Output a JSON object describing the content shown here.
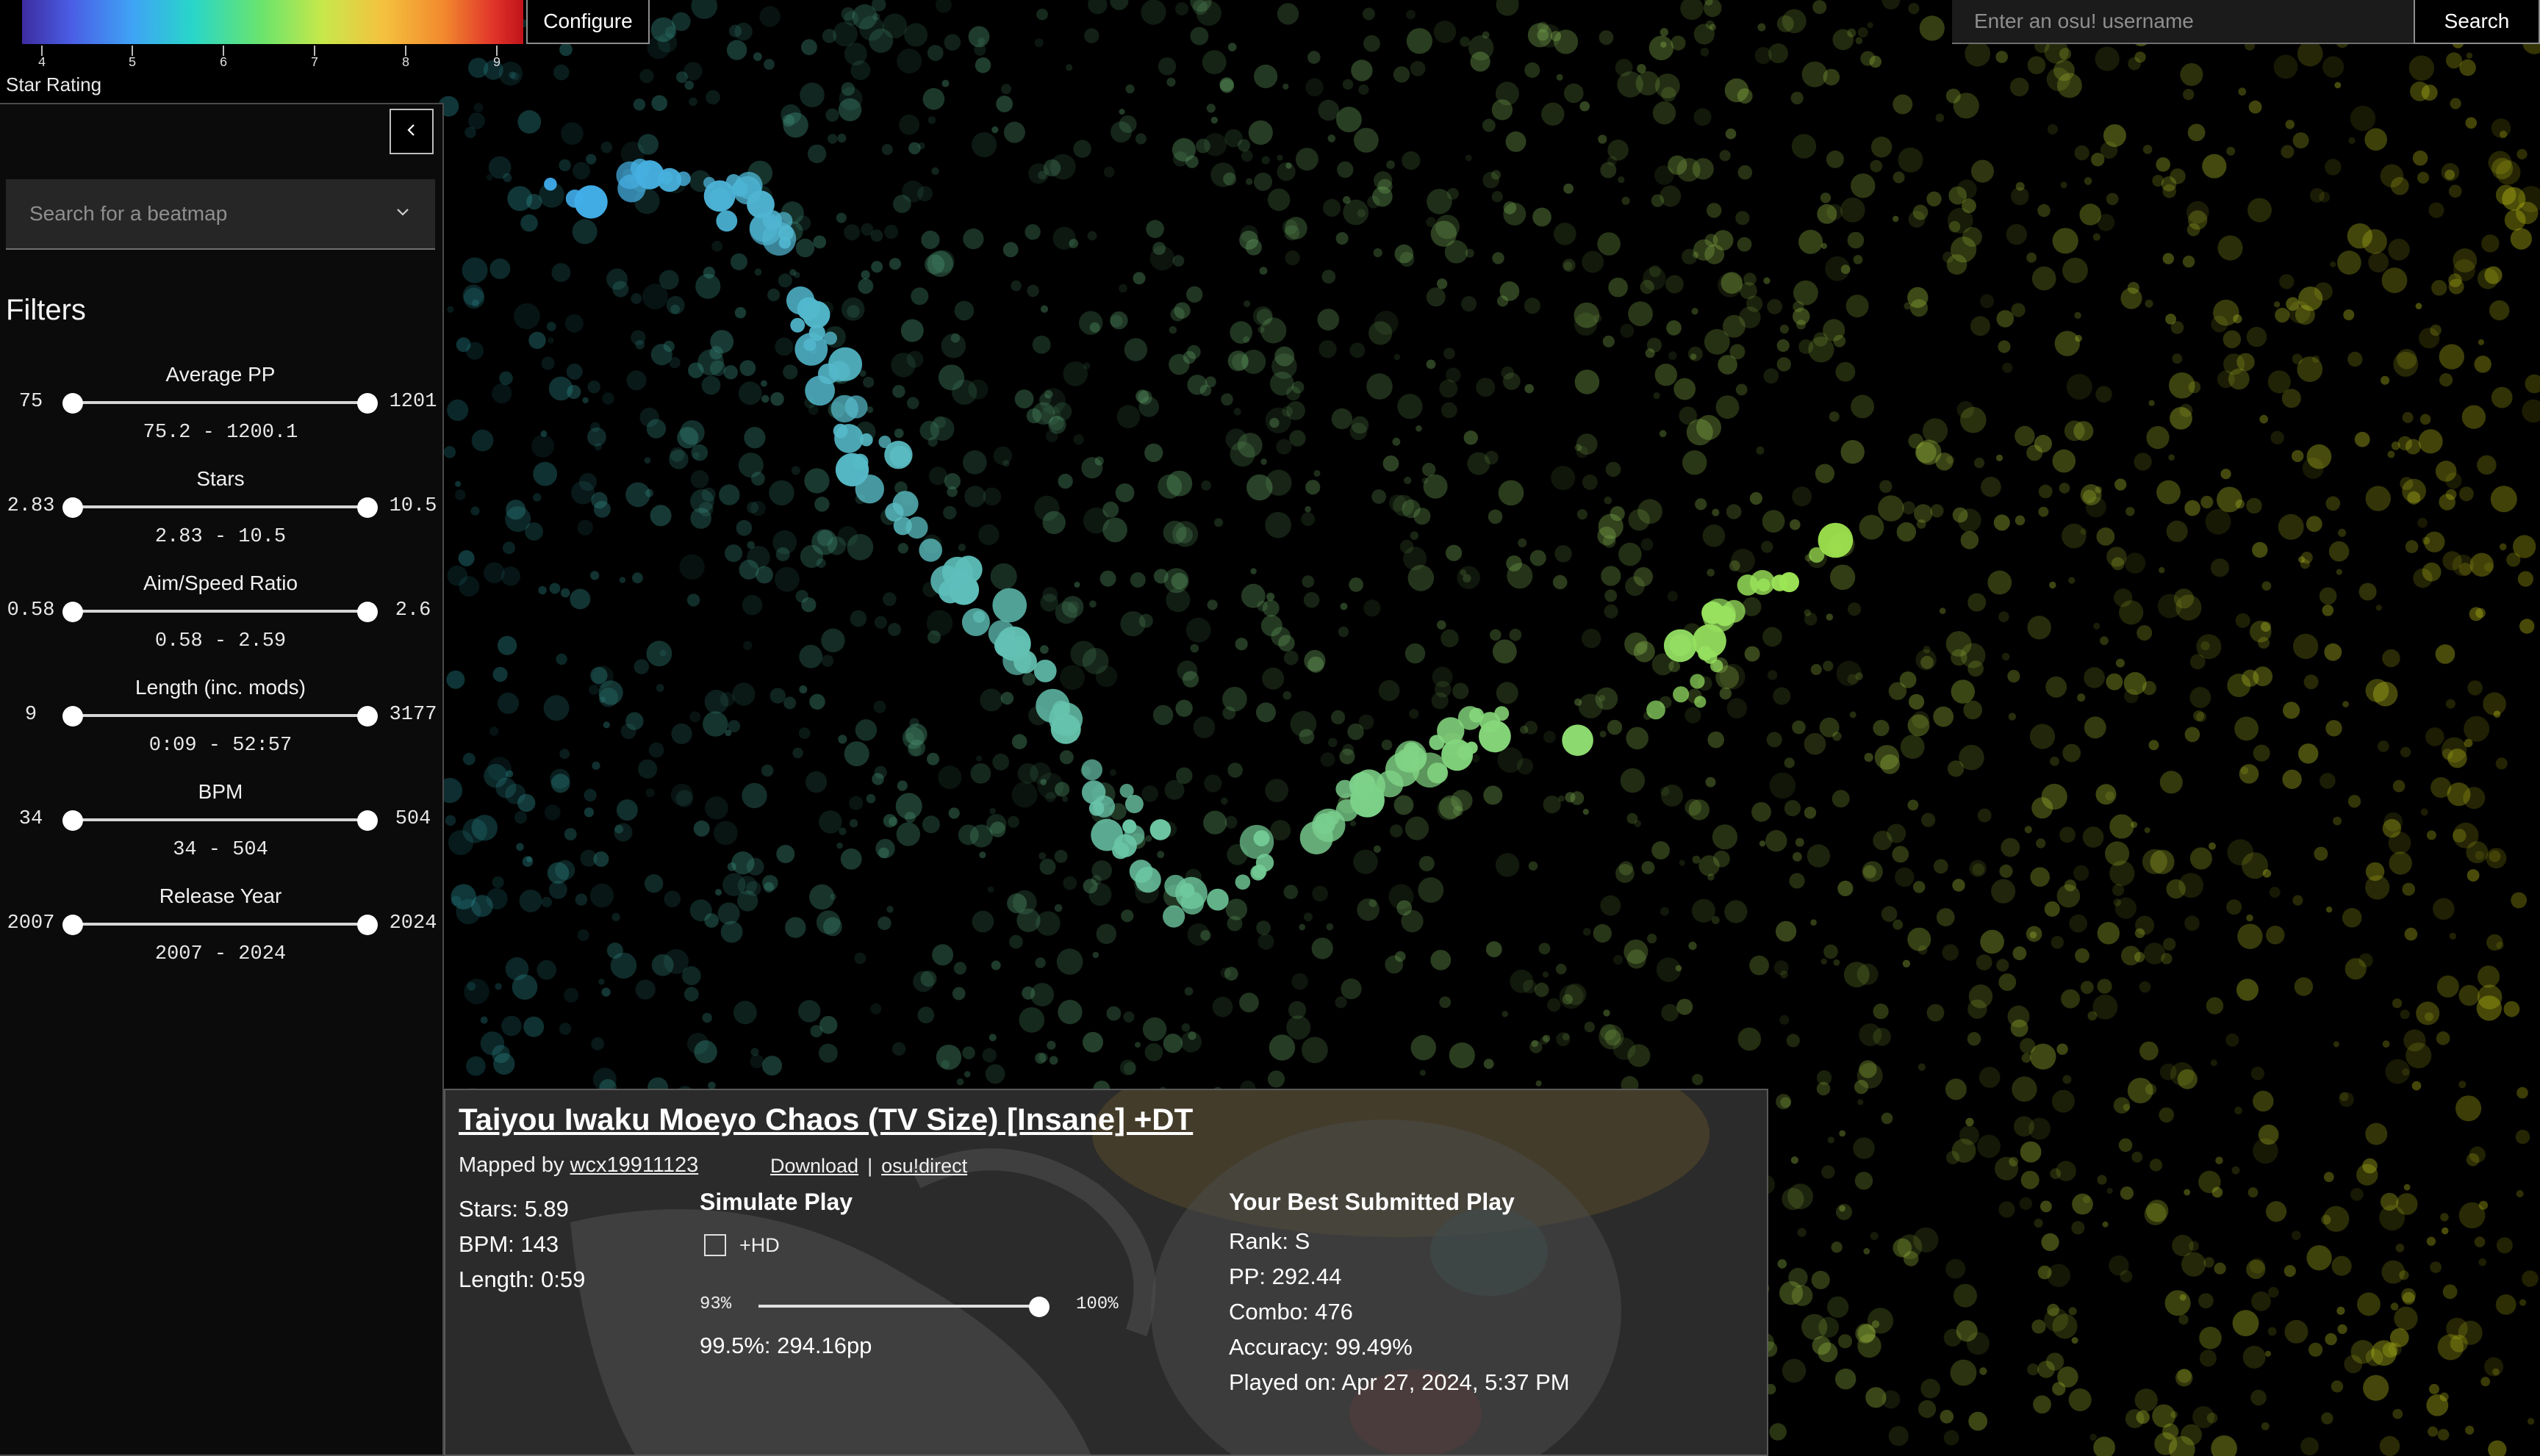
{
  "legend": {
    "ticks": [
      "4",
      "5",
      "6",
      "7",
      "8",
      "9"
    ],
    "title": "Star Rating",
    "configure_label": "Configure"
  },
  "user_search": {
    "placeholder": "Enter an osu! username",
    "button_label": "Search"
  },
  "sidebar": {
    "collapse_icon": "chevron-left-icon",
    "beatmap_search_placeholder": "Search for a beatmap",
    "filters_title": "Filters",
    "filters": [
      {
        "label": "Average PP",
        "min": "75",
        "max": "1201",
        "range": "75.2 - 1200.1"
      },
      {
        "label": "Stars",
        "min": "2.83",
        "max": "10.5",
        "range": "2.83 - 10.5"
      },
      {
        "label": "Aim/Speed Ratio",
        "min": "0.58",
        "max": "2.6",
        "range": "0.58 - 2.59"
      },
      {
        "label": "Length (inc. mods)",
        "min": "9",
        "max": "3177",
        "range": "0:09 - 52:57"
      },
      {
        "label": "BPM",
        "min": "34",
        "max": "504",
        "range": "34 - 504"
      },
      {
        "label": "Release Year",
        "min": "2007",
        "max": "2024",
        "range": "2007 - 2024"
      }
    ]
  },
  "detail": {
    "title": "Taiyou Iwaku Moeyo Chaos (TV Size) [Insane] +DT",
    "mapped_by_prefix": "Mapped by ",
    "mapper": "wcx19911123",
    "download": "Download",
    "separator": "|",
    "osu_direct": "osu!direct",
    "stars": "Stars: 5.89",
    "bpm": "BPM: 143",
    "length": "Length: 0:59",
    "simulate": {
      "title": "Simulate Play",
      "hd_label": "+HD",
      "hd_checked": false,
      "acc_min": "93%",
      "acc_max": "100%",
      "acc_value_fraction": 0.93,
      "result": "99.5%: 294.16pp"
    },
    "best": {
      "title": "Your Best Submitted Play",
      "rank": "Rank: S",
      "pp": "PP: 292.44",
      "combo": "Combo: 476",
      "accuracy": "Accuracy: 99.49%",
      "played_on": "Played on: Apr 27, 2024, 5:37 PM"
    }
  },
  "colors": {
    "background": "#000000",
    "panel": "#2a2a2a",
    "sidebar": "#0b0b0b"
  }
}
